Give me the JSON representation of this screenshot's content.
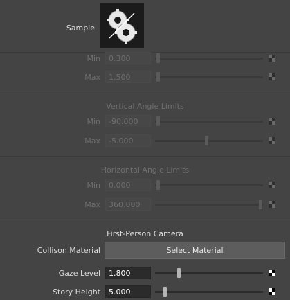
{
  "sample": {
    "label": "Sample",
    "thumbnail_icon": "gears-icon"
  },
  "distance": {
    "rows": [
      {
        "label": "Min",
        "value": "0.300",
        "slider": 0.0
      },
      {
        "label": "Max",
        "value": "1.500",
        "slider": 0.0
      }
    ]
  },
  "vertical": {
    "heading": "Vertical Angle Limits",
    "rows": [
      {
        "label": "Min",
        "value": "-90.000",
        "slider": 0.0
      },
      {
        "label": "Max",
        "value": "-5.000",
        "slider": 0.47
      }
    ]
  },
  "horizontal": {
    "heading": "Horizontal Angle Limits",
    "rows": [
      {
        "label": "Min",
        "value": "0.000",
        "slider": 0.0
      },
      {
        "label": "Max",
        "value": "360.000",
        "slider": 1.0
      }
    ]
  },
  "first_person": {
    "heading": "First-Person Camera",
    "collision_label": "Collison Material",
    "select_button": "Select Material",
    "gaze": {
      "label": "Gaze Level",
      "value": "1.800",
      "slider": 0.2
    },
    "story": {
      "label": "Story Height",
      "value": "5.000",
      "slider": 0.07
    }
  },
  "map_icon": "checker-map-icon",
  "colors": {
    "background": "#444444",
    "field_active": "#2b2b2b",
    "button": "#5d5d5d"
  }
}
